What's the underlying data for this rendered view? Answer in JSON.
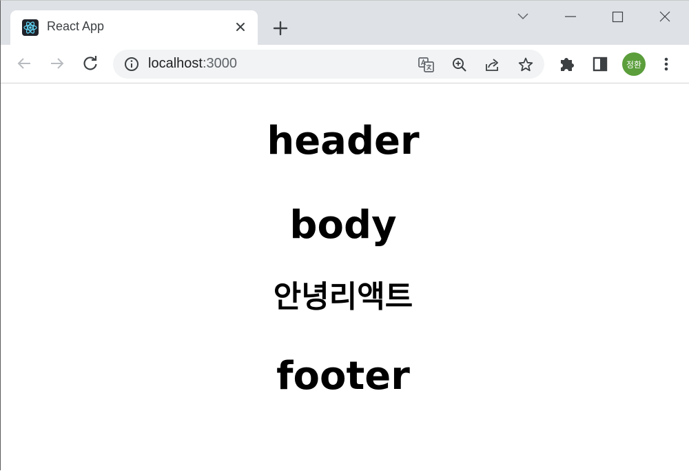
{
  "browser": {
    "tab": {
      "title": "React App",
      "favicon": "react-logo-icon"
    },
    "address_bar": {
      "host": "localhost",
      "port": ":3000"
    },
    "profile": {
      "initials": "정환",
      "color": "#5b9e3b"
    }
  },
  "page": {
    "header": "header",
    "body": "body",
    "greeting": "안녕리액트",
    "footer": "footer"
  }
}
